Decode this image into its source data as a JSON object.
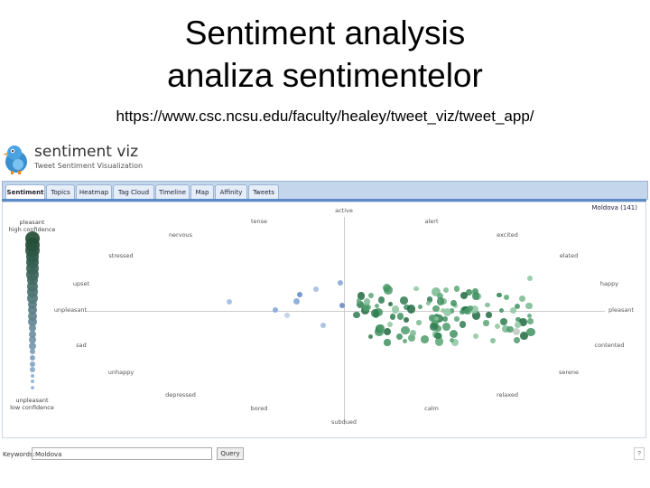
{
  "slide": {
    "title_line1": "Sentiment analysis",
    "title_line2": "analiza sentimentelor",
    "url": "https://www.csc.ncsu.edu/faculty/healey/tweet_viz/tweet_app/"
  },
  "app": {
    "name": "sentiment viz",
    "subtitle": "Tweet Sentiment Visualization",
    "tabs": [
      "Sentiment",
      "Topics",
      "Heatmap",
      "Tag Cloud",
      "Timeline",
      "Map",
      "Affinity",
      "Tweets"
    ],
    "active_tab": "Sentiment",
    "region_label": "Moldova (141)",
    "legend": {
      "top_line1": "pleasant",
      "top_line2": "high confidence",
      "bottom_line1": "unpleasant",
      "bottom_line2": "low confidence"
    },
    "emotions": {
      "active": "active",
      "tense": "tense",
      "alert": "alert",
      "nervous": "nervous",
      "excited": "excited",
      "stressed": "stressed",
      "elated": "elated",
      "upset": "upset",
      "happy": "happy",
      "unpleasant": "unpleasant",
      "pleasant": "pleasant",
      "sad": "sad",
      "contented": "contented",
      "unhappy": "unhappy",
      "serene": "serene",
      "depressed": "depressed",
      "relaxed": "relaxed",
      "bored": "bored",
      "calm": "calm",
      "subdued": "subdued"
    },
    "keywords_label": "Keywords:",
    "keywords_value": "Moldova",
    "query_button": "Query",
    "help_icon": "?"
  }
}
